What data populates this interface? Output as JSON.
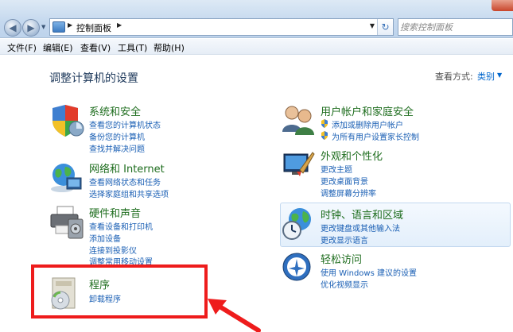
{
  "address": {
    "path": "控制面板",
    "search_placeholder": "搜索控制面板"
  },
  "menu": [
    "文件(F)",
    "编辑(E)",
    "查看(V)",
    "工具(T)",
    "帮助(H)"
  ],
  "page": {
    "title": "调整计算机的设置",
    "view_label": "查看方式:",
    "view_value": "类别"
  },
  "categories": {
    "system": {
      "title": "系统和安全",
      "links": [
        "查看您的计算机状态",
        "备份您的计算机",
        "查找并解决问题"
      ]
    },
    "network": {
      "title": "网络和 Internet",
      "links": [
        "查看网络状态和任务",
        "选择家庭组和共享选项"
      ]
    },
    "hardware": {
      "title": "硬件和声音",
      "links": [
        "查看设备和打印机",
        "添加设备",
        "连接到投影仪",
        "调整常用移动设置"
      ]
    },
    "programs": {
      "title": "程序",
      "links": [
        "卸载程序"
      ]
    },
    "users": {
      "title": "用户帐户和家庭安全",
      "links": [
        "添加或删除用户帐户",
        "为所有用户设置家长控制"
      ]
    },
    "appearance": {
      "title": "外观和个性化",
      "links": [
        "更改主题",
        "更改桌面背景",
        "调整屏幕分辨率"
      ]
    },
    "clock": {
      "title": "时钟、语言和区域",
      "links": [
        "更改键盘或其他输入法",
        "更改显示语言"
      ]
    },
    "ease": {
      "title": "轻松访问",
      "links": [
        "使用 Windows 建议的设置",
        "优化视频显示"
      ]
    }
  },
  "colors": {
    "annotation": "#ee1c1c",
    "category_title": "#1e6d1e",
    "link": "#1a5fb4"
  }
}
